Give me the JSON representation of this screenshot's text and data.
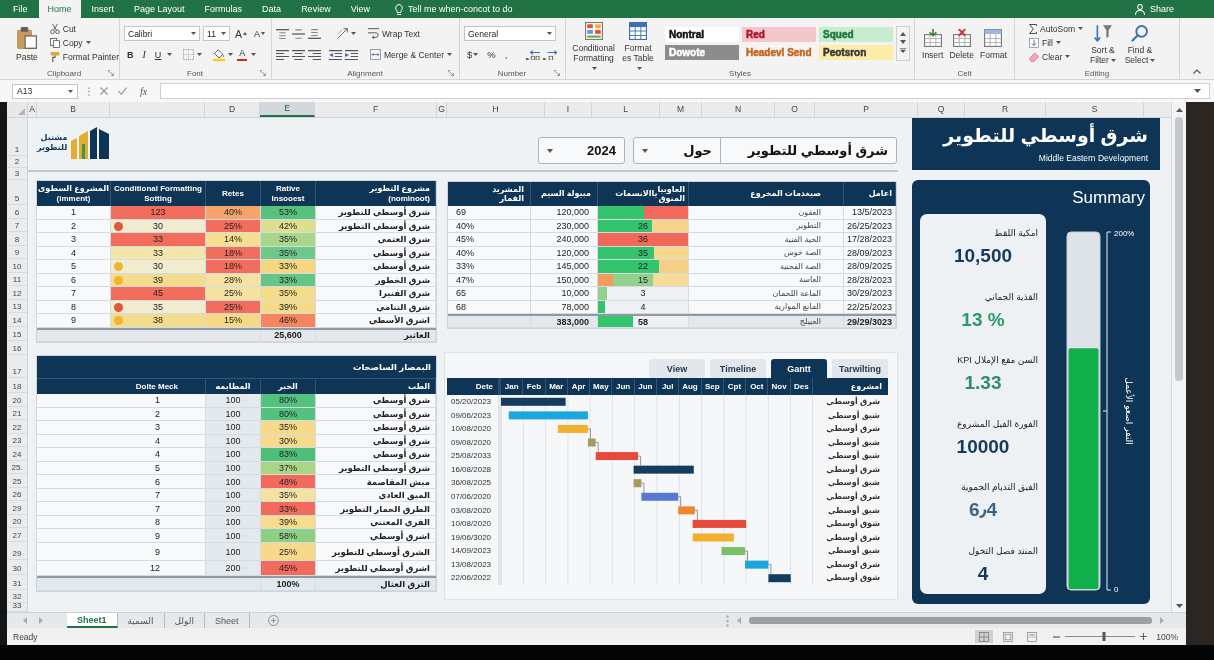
{
  "ribbon": {
    "tabs": [
      {
        "label": "View",
        "selected": false
      },
      {
        "label": "Review",
        "selected": false
      },
      {
        "label": "Data",
        "selected": false
      },
      {
        "label": "Formulas",
        "selected": false
      },
      {
        "label": "Page Layout",
        "selected": false
      },
      {
        "label": "Insert",
        "selected": false
      },
      {
        "label": "Home",
        "selected": true
      },
      {
        "label": "File",
        "selected": false
      }
    ],
    "tell_me": "Tell me when-concot to do",
    "share": "Share",
    "clipboard": {
      "paste": "Paste",
      "tools": [
        "Cut",
        "Copy",
        "Format Painter"
      ],
      "label": "Clipboard"
    },
    "font": {
      "name": "Calibri",
      "size": "11",
      "resize": [
        "A",
        "A"
      ],
      "styles": [
        "U",
        "I",
        "B"
      ],
      "color_letter": "A",
      "label": "Font"
    },
    "alignment": {
      "wrap": "Wrap Text",
      "merge": "Merge & Center",
      "label": "Alignment"
    },
    "number": {
      "format": "General",
      "symbols": [
        ",",
        "%",
        "$"
      ],
      "label": "Number"
    },
    "styles": {
      "conditional": "Conditional Formatting",
      "table": "Format es Table",
      "gallery": [
        {
          "label": "Squed",
          "color": "#c7ecd0",
          "font": {
            "color": "#1d7a3a"
          }
        },
        {
          "label": "Red",
          "color": "#f6c6cd",
          "font": {
            "color": "#b0162a"
          }
        },
        {
          "label": "Nontral",
          "color": "#ffffff",
          "font": {
            "color": "#111111"
          }
        },
        {
          "label": "Peotsron",
          "color": "#fdeca6"
        },
        {
          "label": "Headevl Send",
          "color": "#f4f4f4",
          "font": {
            "color": "#c6651b"
          }
        },
        {
          "label": "Dowote",
          "color": "#8c8c8c"
        }
      ],
      "label": "Styles"
    },
    "cells": {
      "tools": [
        "Format",
        "Delete",
        "Insert"
      ],
      "label": "Celt"
    },
    "editing": {
      "tools": [
        "AutoSom",
        "Fill",
        "Clear"
      ],
      "sort": "Sort & Filter",
      "find": "Find & Select",
      "label": "Editing"
    }
  },
  "formula_bar": {
    "cell": "A13",
    "fx": "fx"
  },
  "columns": [
    {
      "label": "S",
      "selected": false
    },
    {
      "label": "R",
      "selected": false
    },
    {
      "label": "Q",
      "selected": false
    },
    {
      "label": "P",
      "selected": false
    },
    {
      "label": "O",
      "selected": false
    },
    {
      "label": "N",
      "selected": false
    },
    {
      "label": "M",
      "selected": false
    },
    {
      "label": "L",
      "selected": false
    },
    {
      "label": "I",
      "selected": false
    },
    {
      "label": "H",
      "selected": false
    },
    {
      "label": "G",
      "selected": false
    },
    {
      "label": "F",
      "selected": false
    },
    {
      "label": "E",
      "selected": true
    },
    {
      "label": "D",
      "selected": false
    },
    {
      "label": "B",
      "selected": false
    },
    {
      "label": "A",
      "selected": false
    }
  ],
  "row_numbers": [
    "1",
    "2",
    "3",
    "5",
    "6",
    "7",
    "8",
    "9",
    "10",
    "11",
    "12",
    "13",
    "14",
    "15",
    "16",
    "17",
    "18",
    "20",
    "21",
    "22",
    "23",
    "24",
    "25.",
    "25",
    "26",
    "29",
    "20",
    "27",
    "29",
    "30",
    "31",
    "32",
    "33"
  ],
  "logo": {
    "text": "مشتبل للتطوير"
  },
  "selectors": {
    "year": "2024",
    "period": "حول",
    "project": "شرق أوسطي للتطوير"
  },
  "banner": {
    "title": "شرق أوسطي للتطوير",
    "subtitle": "Middle Eastern Development"
  },
  "projects_table": {
    "columns": [
      "مشروع التطوير\n(nominoot)",
      "Rative\nInsooest",
      "Retes",
      "Conditional Formatting\nSotting",
      "المشروع السطوى\n(imment)"
    ],
    "rows": [
      {
        "number": "1",
        "score": {
          "text": "123",
          "color": "#f26d5b"
        },
        "rate": {
          "text": "40%",
          "color": "#f5a46c"
        },
        "ratio": {
          "text": "53%",
          "color": "#57c27d"
        },
        "name": "شرق أوسطي للتطوير"
      },
      {
        "number": "2",
        "score": {
          "text": "30",
          "color": "#f1ecd0",
          "dot": {
            "color": "#e4533b"
          }
        },
        "rate": {
          "text": "25%",
          "color": "#f26d5b"
        },
        "ratio": {
          "text": "42%",
          "color": "#dcdf8f"
        },
        "name": "شرق أوسطي التطوير"
      },
      {
        "number": "3",
        "score": {
          "text": "33",
          "color": "#f26d5b"
        },
        "rate": {
          "text": "14%",
          "color": "#f6df90"
        },
        "ratio": {
          "text": "35%",
          "color": "#a8d68a"
        },
        "name": "شرق العتمي"
      },
      {
        "number": "4",
        "score": {
          "text": "33",
          "color": "#f3e6a8"
        },
        "rate": {
          "text": "18%",
          "color": "#f26d5b"
        },
        "ratio": {
          "text": "35%",
          "color": "#6cc98a"
        },
        "name": "شرق أوسطي"
      },
      {
        "number": "5",
        "score": {
          "text": "30",
          "color": "#f1ecd0",
          "dot": {
            "color": "#f0b52c"
          }
        },
        "rate": {
          "text": "18%",
          "color": "#f26d5b"
        },
        "ratio": {
          "text": "33%",
          "color": "#f6d77f"
        },
        "name": "شرق أوسطي"
      },
      {
        "number": "6",
        "score": {
          "text": "39",
          "color": "#f3dc8d",
          "dot": {
            "color": "#f0b52c"
          }
        },
        "rate": {
          "text": "28%",
          "color": "#f6e2a0"
        },
        "ratio": {
          "text": "33%",
          "color": "#65c587"
        },
        "name": "شرق الخطور"
      },
      {
        "number": "7",
        "score": {
          "text": "45",
          "color": "#f26d5b"
        },
        "rate": {
          "text": "25%",
          "color": "#f6e2a0"
        },
        "ratio": {
          "text": "35%",
          "color": "#f5dc8a"
        },
        "name": "شرق الفنيرا"
      },
      {
        "number": "8",
        "score": {
          "text": "35",
          "color": "#f1ecd0",
          "dot": {
            "color": "#e4533b"
          }
        },
        "rate": {
          "text": "25%",
          "color": "#f26d5b"
        },
        "ratio": {
          "text": "39%",
          "color": "#f5db86"
        },
        "name": "شرق التنامي"
      },
      {
        "number": "9",
        "score": {
          "text": "38",
          "color": "#f3dc8d",
          "dot": {
            "color": "#f0b52c"
          }
        },
        "rate": {
          "text": "15%",
          "color": "#f5d985"
        },
        "ratio": {
          "text": "46%",
          "color": "#f3865f"
        },
        "name": "اشرق الأسطي"
      }
    ],
    "total": {
      "ratio": "25,600",
      "name": "العاثير"
    }
  },
  "cost_table": {
    "columns": [
      {
        "label": "اعامل"
      },
      {
        "label": "صيغدمات المخروع"
      },
      {
        "label": "العاوبيا\nالمنوق",
        "label_2": "ياالانسمات"
      },
      {
        "label": "مبيولة السيم"
      },
      {
        "label": "المشريد\nالقمار"
      }
    ],
    "rows": [
      {
        "share": "69",
        "amount": "120,000",
        "bar": {
          "color": "#f2685a",
          "segments": [
            {
              "level": 0.51,
              "color": "#35c46e"
            }
          ]
        },
        "item": "العقون",
        "date": "13/5/2023"
      },
      {
        "share": "40%",
        "amount": "230,000",
        "bar": {
          "color": "#f7d48c",
          "segments": [
            {
              "level": 0.6,
              "color": "#35c46e"
            }
          ],
          "value": "26"
        },
        "item": "التطوير",
        "date": "26/25/2023"
      },
      {
        "share": "45%",
        "amount": "240,000",
        "bar": {
          "color": "#f2685a",
          "value": "36"
        },
        "item": "الحية الفنية",
        "date": "17/28/2023"
      },
      {
        "share": "40%",
        "amount": "120,000",
        "bar": {
          "color": "#f6d98c",
          "segments": [
            {
              "level": 0.62,
              "color": "#35c46e"
            }
          ],
          "value": "35"
        },
        "item": "الصة خوس",
        "date": "28/09/2023"
      },
      {
        "share": "33%",
        "amount": "145,000",
        "bar": {
          "color": "#f6cf86",
          "segments": [
            {
              "level": 0.68,
              "color": "#35c46e"
            }
          ],
          "value": "22"
        },
        "item": "الصة الفحنية",
        "date": "28/09/2025"
      },
      {
        "share": "47%",
        "amount": "150,000",
        "bar": {
          "color": "#f6dc98",
          "segments": [
            {
              "level": 0.17,
              "color": "#f29c5e"
            },
            {
              "level": 0.44,
              "color": "#93d08e"
            }
          ],
          "value": "15"
        },
        "item": "العاسة",
        "date": "28/28/2023"
      },
      {
        "share": "65",
        "amount": "10,000",
        "bar": {
          "segments": [
            {
              "level": 0.1,
              "color": "#93d08e"
            }
          ],
          "value": "3"
        },
        "item": "الماعة اللحمان",
        "date": "30/29/2023"
      },
      {
        "share": "68",
        "amount": "78,000",
        "bar": {
          "segments": [
            {
              "level": 0.08,
              "color": "#35c46e"
            }
          ],
          "value": "4"
        },
        "item": "المانع الموارية",
        "date": "22/25/2023"
      }
    ],
    "total": {
      "amount": "383,000",
      "bar": {
        "segments": [
          {
            "level": 0.39,
            "color": "#35c46e"
          }
        ],
        "value": "58"
      },
      "item": "العبيلج",
      "date": "29/29/3023"
    }
  },
  "summary": {
    "title": "Summary",
    "kpis": [
      {
        "label": "امكية اللقط",
        "value": "10,500",
        "color": "#173a5a"
      },
      {
        "label": "القذية الجماني",
        "value": "13 %",
        "color": "#2b9a6a"
      },
      {
        "label": "KPI السن مقع الإملال",
        "value": "1.33",
        "color": "#2e8c74"
      },
      {
        "label": "الفورة الفيل المشروع",
        "value": "10000",
        "color": "#173a5a"
      },
      {
        "label": "الفيق التديام الجموية",
        "value": "6٫4",
        "color": "#3c6585"
      },
      {
        "label": "المنند فصل التخول",
        "value": "4",
        "color": "#173a5a"
      }
    ],
    "chart_data": [
      {
        "type": "bar",
        "ylabel": "النفر اصعو الأعمل",
        "categories": [
          null
        ],
        "values": [
          135
        ],
        "color": "#12b04c",
        "ylim": [
          0,
          200
        ],
        "yticks": [
          {
            "value": 0,
            "label": "0"
          },
          {
            "value": 200,
            "label": "200%"
          }
        ]
      }
    ]
  },
  "allocation_table": {
    "title": "البمصار الساصحات",
    "columns": [
      "الطب",
      "الخبر",
      "المطايمه",
      "Dolte Meck"
    ],
    "rows": [
      {
        "number": "1",
        "quantity": "100",
        "share": {
          "text": "80%",
          "color": "#52c27e"
        },
        "name": "شرق أوسطي"
      },
      {
        "number": "2",
        "quantity": "100",
        "share": {
          "text": "80%",
          "color": "#52c27e"
        },
        "name": "شرق أوسطي"
      },
      {
        "number": "3",
        "quantity": "100",
        "share": {
          "text": "35%",
          "color": "#f6d98a"
        },
        "name": "شرق أوسطي"
      },
      {
        "number": "4",
        "quantity": "100",
        "share": {
          "text": "30%",
          "color": "#f6d98a"
        },
        "name": "شرق أوسطي"
      },
      {
        "number": "4",
        "quantity": "100",
        "share": {
          "text": "83%",
          "color": "#4dbf78"
        },
        "name": "شرق أوسطي"
      },
      {
        "number": "5",
        "quantity": "100",
        "share": {
          "text": "37%",
          "color": "#a9d587"
        },
        "name": "شرق أوسطي التطوير"
      },
      {
        "number": "6",
        "quantity": "100",
        "share": {
          "text": "48%",
          "color": "#f26a5c"
        },
        "name": "ميش المقاصمة"
      },
      {
        "number": "7",
        "quantity": "100",
        "share": {
          "text": "35%",
          "color": "#f6e2a0"
        },
        "name": "الميق العادي"
      },
      {
        "number": "7",
        "quantity": "200",
        "share": {
          "text": "33%",
          "color": "#f26a5c"
        },
        "name": "الطرق الحمار التطوير"
      },
      {
        "number": "8",
        "quantity": "100",
        "share": {
          "text": "39%",
          "color": "#f6dc8e"
        },
        "name": "الفري المعتني"
      },
      {
        "number": "9",
        "quantity": "100",
        "share": {
          "text": "58%",
          "color": "#8ccf85"
        },
        "name": "اشرق أوسطي"
      },
      {
        "number": "9",
        "quantity": "100",
        "share": {
          "text": "25%",
          "color": "#f6d98a"
        },
        "name": "الشرق أوسطي للتطوير"
      },
      {
        "number": "12",
        "quantity": "200",
        "share": {
          "text": "45%",
          "color": "#f26a5c"
        },
        "name": "اشرق أوسطي للتطوير"
      }
    ],
    "total": {
      "share": "100%",
      "name": "الترق العثال"
    }
  },
  "timeline": {
    "tabs": [
      {
        "label": "Tarwilting",
        "selected": false
      },
      {
        "label": "Gantt",
        "selected": true
      },
      {
        "label": "Timeline",
        "selected": false
      },
      {
        "label": "View",
        "selected": false
      }
    ],
    "date_header": "Dete",
    "months": [
      "Des",
      "Nov",
      "Oct",
      "Cpt",
      "Sep",
      "Aug",
      "Jul",
      "Jun",
      "Jun",
      "May",
      "Apr",
      "Mar",
      "Feb",
      "Jan"
    ],
    "project_header": "امشروع",
    "rows": [
      {
        "date": "05/20/2023",
        "project": "شرق أوسطي"
      },
      {
        "date": "09/06/2023",
        "project": "شيق أوسطي"
      },
      {
        "date": "10/08/2020",
        "project": "شرق أوسطي"
      },
      {
        "date": "09/08/2020",
        "project": "شيق أوسطي"
      },
      {
        "date": "25/08/2033",
        "project": "شيق أوسطي"
      },
      {
        "date": "16/08/2028",
        "project": "شرق أوسطي"
      },
      {
        "date": "36/08/2025",
        "project": "شيق أوسطي"
      },
      {
        "date": "07/06/2020",
        "project": "شرق أوسطي"
      },
      {
        "date": "03/08/2020",
        "project": "شيق أوسطي"
      },
      {
        "date": "10/08/2020",
        "project": "شوق أوسطي"
      },
      {
        "date": "19/06/3020",
        "project": "شرق أوسطي"
      },
      {
        "date": "14/09/2023",
        "project": "شيق أوسطي"
      },
      {
        "date": "13/08/2023",
        "project": "شرق اوسطي"
      },
      {
        "date": "22/06/2022",
        "project": "شوق أوسطي"
      }
    ]
  },
  "sheet_tabs": [
    {
      "label": "Sheet",
      "selected": false
    },
    {
      "label": "الولل",
      "selected": false
    },
    {
      "label": "السمية",
      "selected": false
    },
    {
      "label": "Sheet1",
      "selected": true
    }
  ],
  "status_bar": {
    "status": "Ready",
    "views": [
      {
        "selected": false
      },
      {
        "selected": false
      },
      {
        "selected": true
      }
    ],
    "zoom_slider": {
      "level": 0.55
    },
    "zoom": "100%"
  }
}
